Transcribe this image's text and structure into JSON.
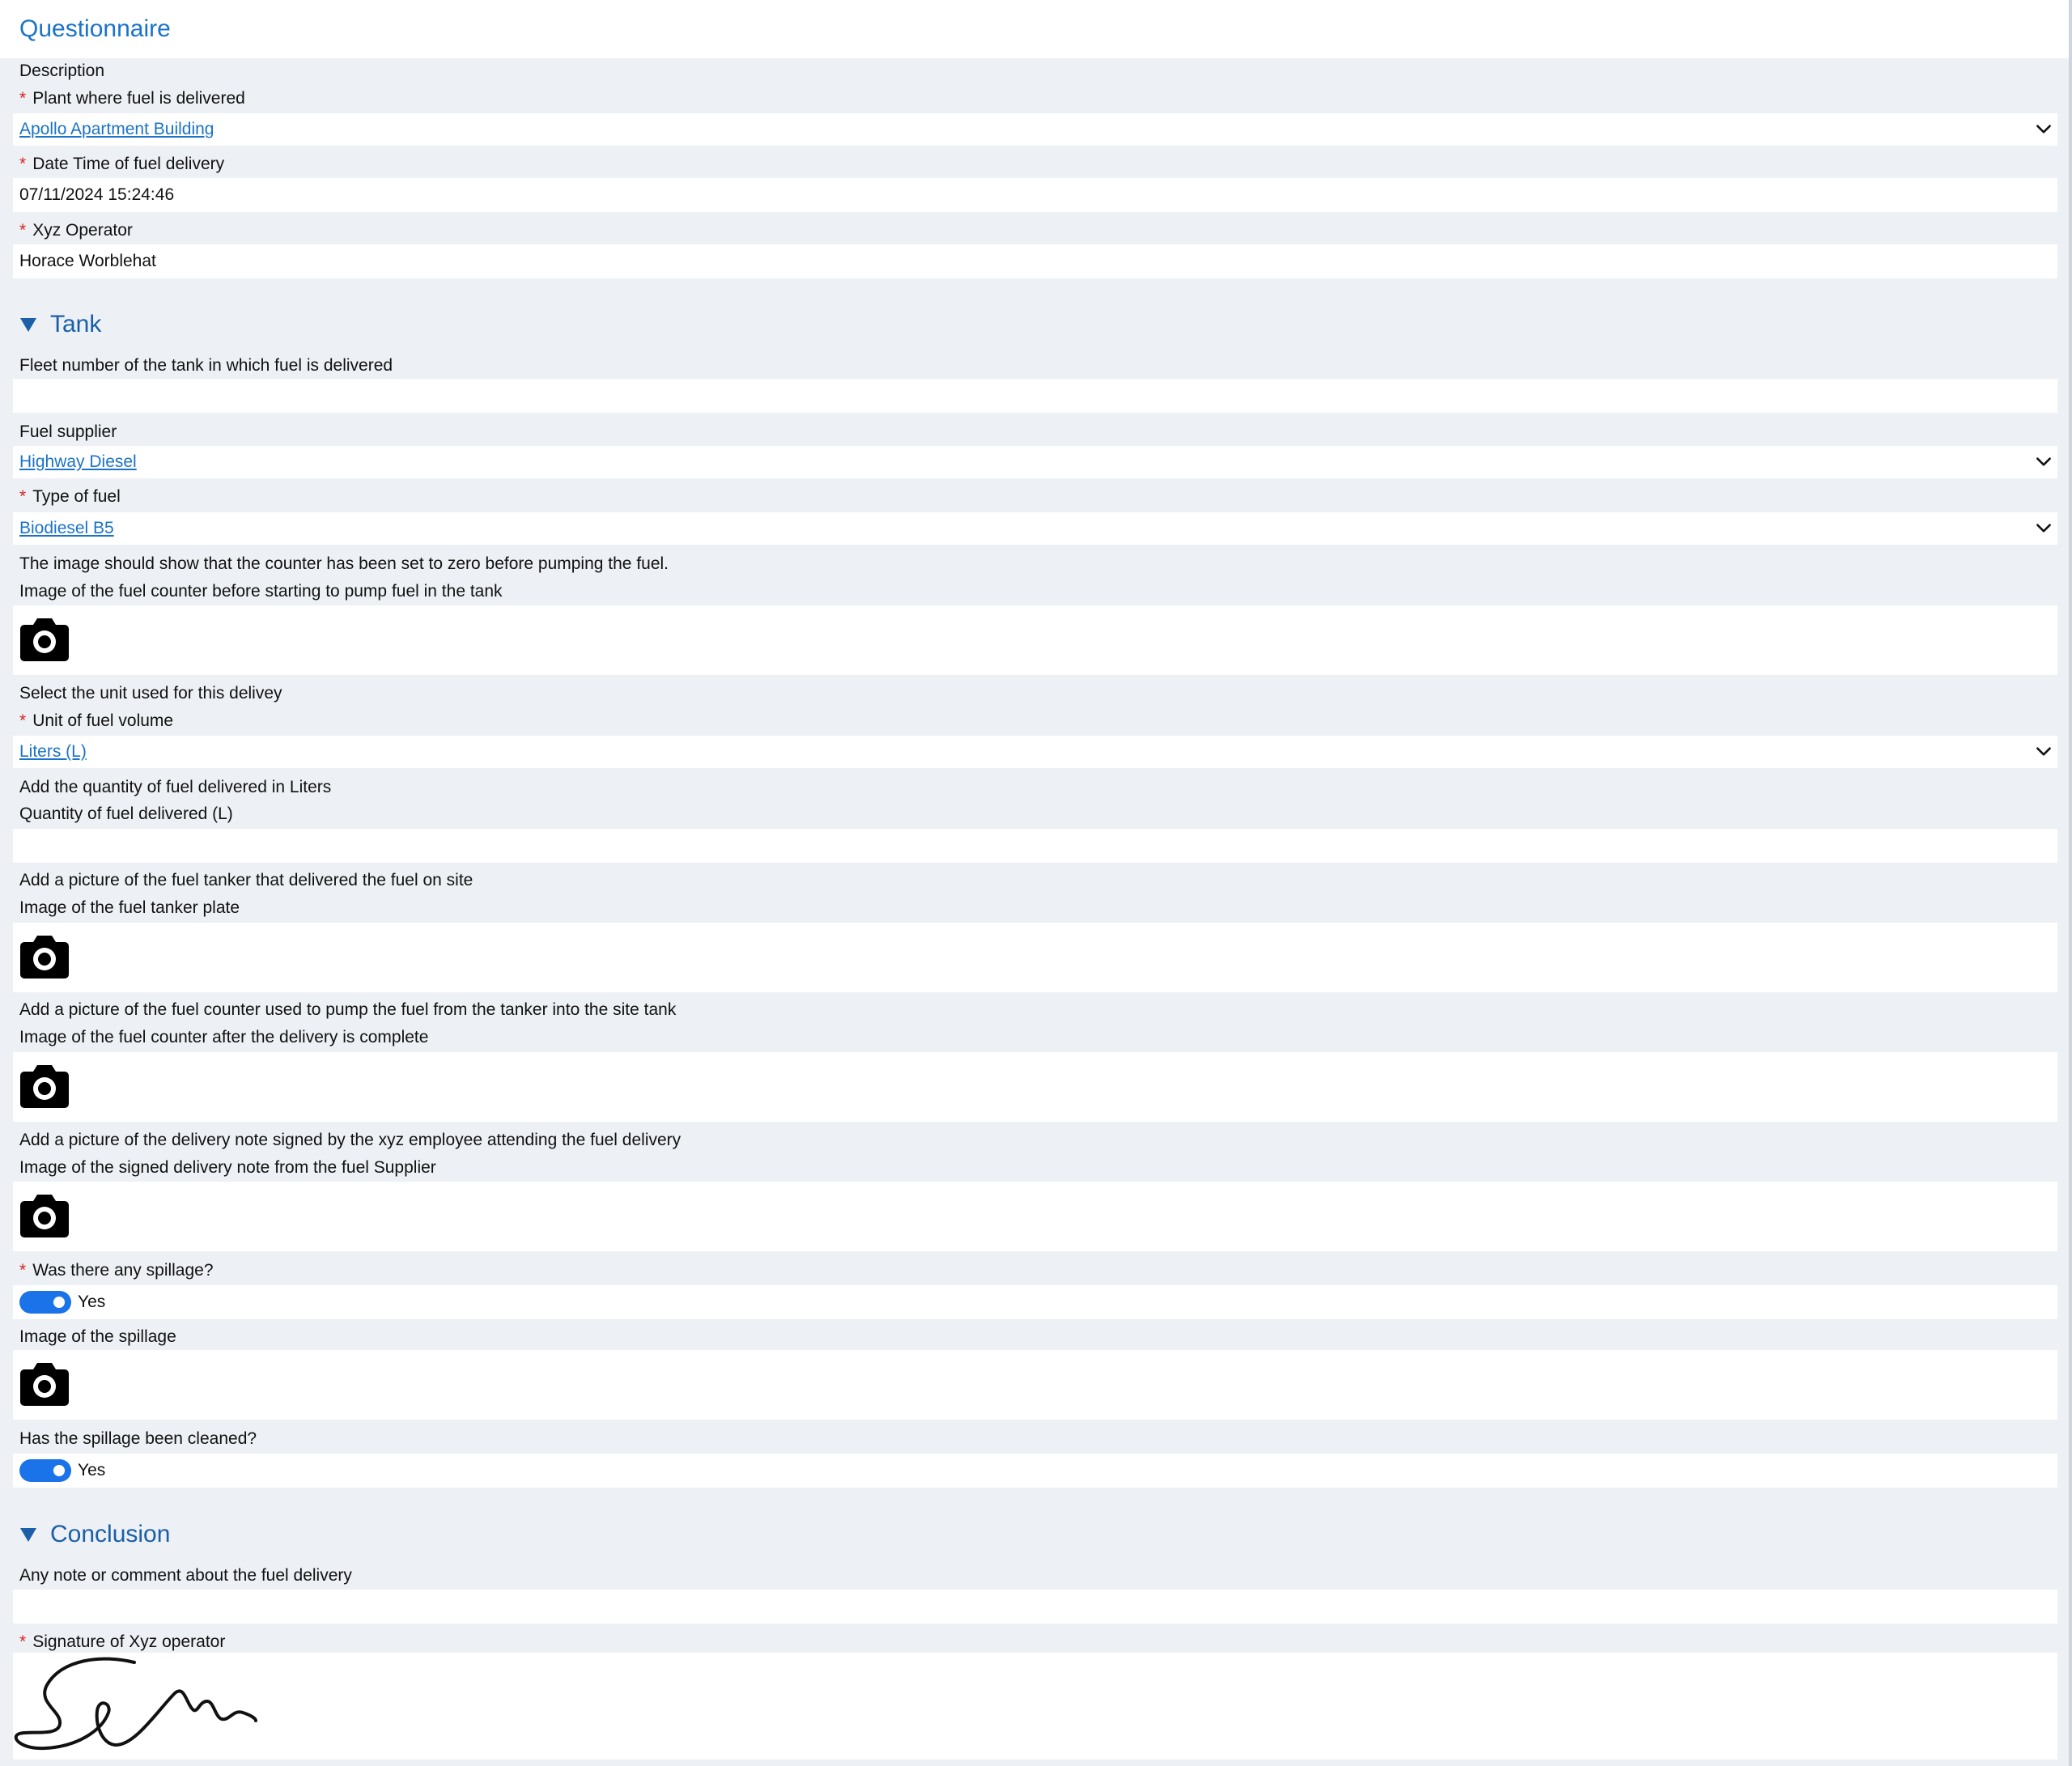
{
  "title": "Questionnaire",
  "description_label": "Description",
  "plant": {
    "label": "Plant where fuel is delivered",
    "value": "Apollo Apartment Building"
  },
  "delivery_datetime": {
    "label": "Date Time of fuel delivery",
    "value": "07/11/2024 15:24:46"
  },
  "operator": {
    "label": "Xyz Operator",
    "value": "Horace Worblehat"
  },
  "tank_section": {
    "title": "Tank",
    "fleet_number": {
      "label": "Fleet number of the tank in which fuel is delivered",
      "value": ""
    },
    "fuel_supplier": {
      "label": "Fuel supplier",
      "value": "Highway Diesel"
    },
    "fuel_type": {
      "label": "Type of fuel",
      "value": "Biodiesel B5"
    },
    "counter_hint": "The image should show that the counter has been set to zero before pumping the fuel.",
    "counter_before_image": {
      "label": "Image of the fuel counter before starting to pump fuel in the tank"
    },
    "unit_hint": "Select the unit used for this delivey",
    "volume_unit": {
      "label": "Unit of fuel volume",
      "value": "Liters (L)"
    },
    "quantity_hint": "Add the quantity of fuel delivered in Liters",
    "quantity": {
      "label": "Quantity of fuel delivered (L)",
      "value": ""
    },
    "tanker_hint": "Add a picture of the fuel tanker that delivered the fuel on site",
    "tanker_plate_image": {
      "label": "Image of the fuel tanker plate"
    },
    "counter_after_hint": "Add a picture of the fuel counter used to pump the fuel from the tanker into the site tank",
    "counter_after_image": {
      "label": "Image of the fuel counter after the delivery is complete"
    },
    "delivery_note_hint": "Add a picture of the delivery note signed by the xyz employee attending the fuel delivery",
    "delivery_note_image": {
      "label": "Image of the signed delivery note from the fuel Supplier"
    },
    "spillage": {
      "label": "Was there any spillage?",
      "value": "Yes"
    },
    "spillage_image": {
      "label": "Image of the spillage"
    },
    "spillage_cleaned": {
      "label": "Has the spillage been cleaned?",
      "value": "Yes"
    }
  },
  "conclusion_section": {
    "title": "Conclusion",
    "comment": {
      "label": "Any note or comment about the fuel delivery",
      "value": ""
    },
    "signature": {
      "label": "Signature of Xyz operator"
    }
  },
  "icons": {
    "camera": "camera-icon",
    "dropdown": "chevron-down-icon",
    "section_toggle": "triangle-down-icon"
  },
  "colors": {
    "accent": "#1a73c8",
    "required": "#dd2222",
    "toggle_on": "#1a73e8",
    "background": "#edf0f4"
  }
}
